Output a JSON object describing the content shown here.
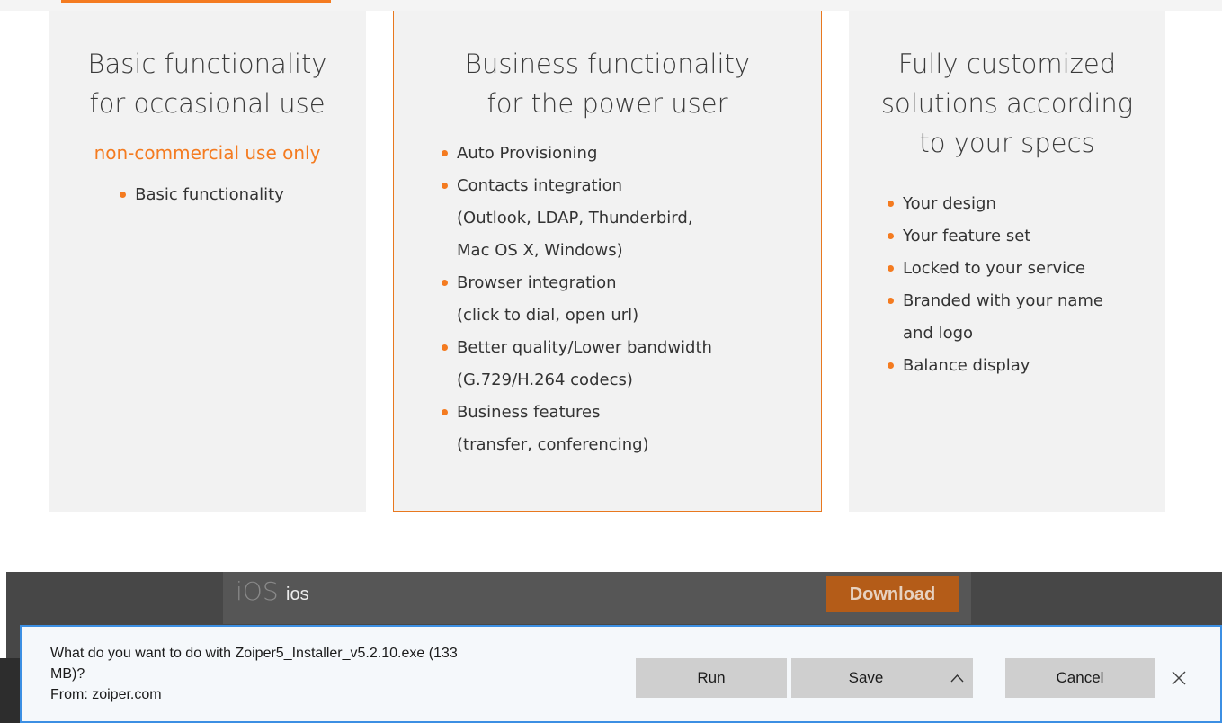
{
  "plans": [
    {
      "title_lines": [
        "Basic functionality",
        "for occasional use"
      ],
      "note": "non-commercial use only",
      "features": [
        "Basic functionality"
      ]
    },
    {
      "title_lines": [
        "Business functionality",
        "for the power user"
      ],
      "features": [
        [
          "Auto Provisioning"
        ],
        [
          "Contacts integration",
          "(Outlook, LDAP, Thunderbird,",
          "Mac OS X, Windows)"
        ],
        [
          "Browser integration",
          "(click to dial, open url)"
        ],
        [
          "Better quality/Lower bandwidth",
          "(G.729/H.264 codecs)"
        ],
        [
          "Business features",
          "(transfer, conferencing)"
        ]
      ]
    },
    {
      "title_lines": [
        "Fully customized",
        "solutions according",
        "to your specs"
      ],
      "features": [
        [
          "Your design"
        ],
        [
          "Your feature set"
        ],
        [
          "Locked to your service"
        ],
        [
          "Branded with your name",
          "and logo"
        ],
        [
          "Balance display"
        ]
      ]
    }
  ],
  "platform_row": {
    "logo_text": "iOS",
    "label": "ios",
    "download_label": "Download"
  },
  "download_prompt": {
    "line1": "What do you want to do with Zoiper5_Installer_v5.2.10.exe (133",
    "line2": "MB)?",
    "line3": "From: zoiper.com",
    "run_label": "Run",
    "save_label": "Save",
    "cancel_label": "Cancel"
  },
  "colors": {
    "accent": "#f47b20",
    "card_bg": "#f2f2f2",
    "dark_band": "#474747",
    "download_button": "#b45c18",
    "prompt_border": "#3c8fe3"
  },
  "icons": {
    "save_menu": "chevron-up-icon",
    "close": "close-icon",
    "bullet": "bullet-dot-icon"
  }
}
